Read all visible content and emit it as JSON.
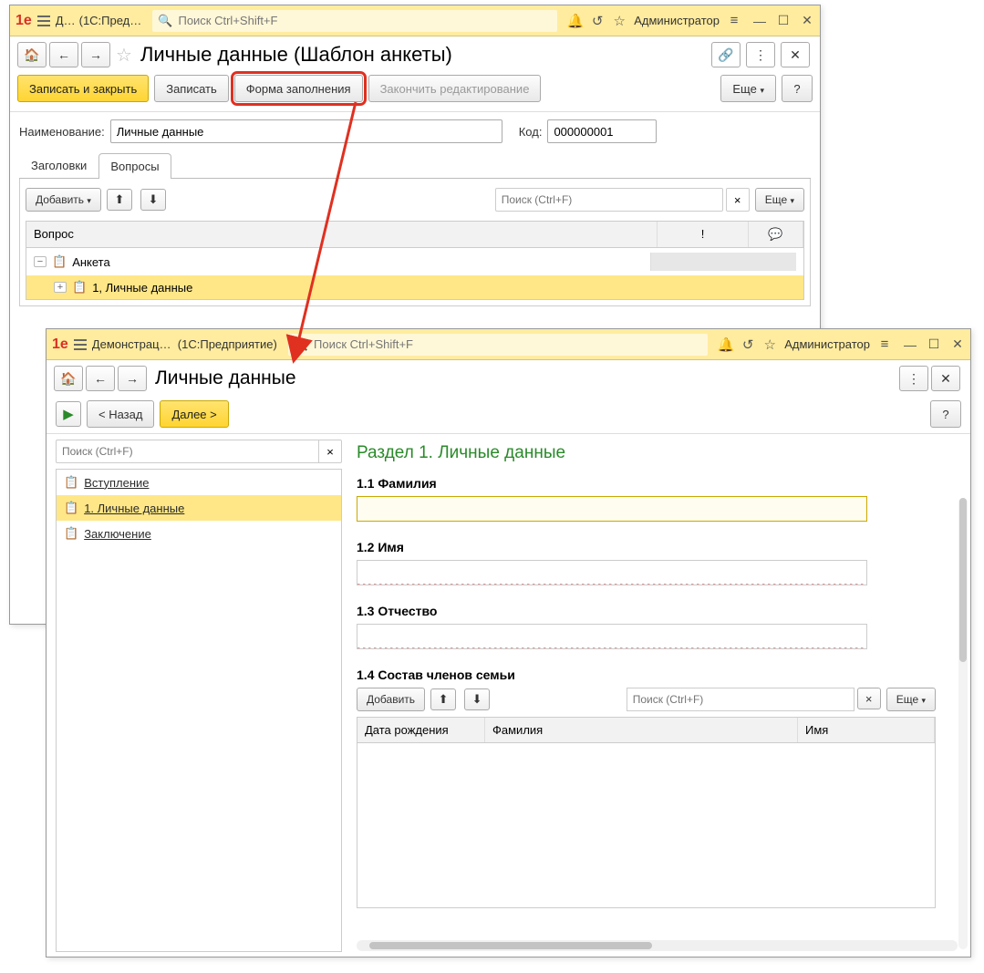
{
  "win1": {
    "titlebar": {
      "doc_label": "Д…",
      "app_label": "(1С:Пред…",
      "search_placeholder": "Поиск Ctrl+Shift+F",
      "admin": "Администратор"
    },
    "caption": "Личные данные (Шаблон анкеты)",
    "actions": {
      "save_close": "Записать и закрыть",
      "save": "Записать",
      "fill_form": "Форма заполнения",
      "finish_edit": "Закончить редактирование",
      "more": "Еще",
      "help": "?"
    },
    "fields": {
      "name_label": "Наименование:",
      "name_value": "Личные данные",
      "code_label": "Код:",
      "code_value": "000000001"
    },
    "tabs": {
      "headers": "Заголовки",
      "questions": "Вопросы"
    },
    "toolbar": {
      "add": "Добавить",
      "search_placeholder": "Поиск (Ctrl+F)",
      "more": "Еще"
    },
    "grid": {
      "col_question": "Вопрос",
      "row_root": "Анкета",
      "row_child": "1, Личные данные"
    }
  },
  "win2": {
    "titlebar": {
      "doc_label": "Демонстрацио…",
      "app_label": "(1С:Предприятие)",
      "search_placeholder": "Поиск Ctrl+Shift+F",
      "admin": "Администратор"
    },
    "caption": "Личные данные",
    "actions": {
      "back": "< Назад",
      "next": "Далее >",
      "help": "?"
    },
    "sidebar": {
      "search_placeholder": "Поиск (Ctrl+F)",
      "items": [
        "Вступление",
        "1. Личные данные",
        "Заключение"
      ]
    },
    "main": {
      "section_title": "Раздел 1. Личные данные",
      "q1": "1.1 Фамилия",
      "q2": "1.2 Имя",
      "q3": "1.3 Отчество",
      "q4": "1.4 Состав членов семьи",
      "inner_toolbar": {
        "add": "Добавить",
        "search_placeholder": "Поиск (Ctrl+F)",
        "more": "Еще"
      },
      "inner_cols": {
        "c1": "Дата рождения",
        "c2": "Фамилия",
        "c3": "Имя"
      }
    }
  }
}
